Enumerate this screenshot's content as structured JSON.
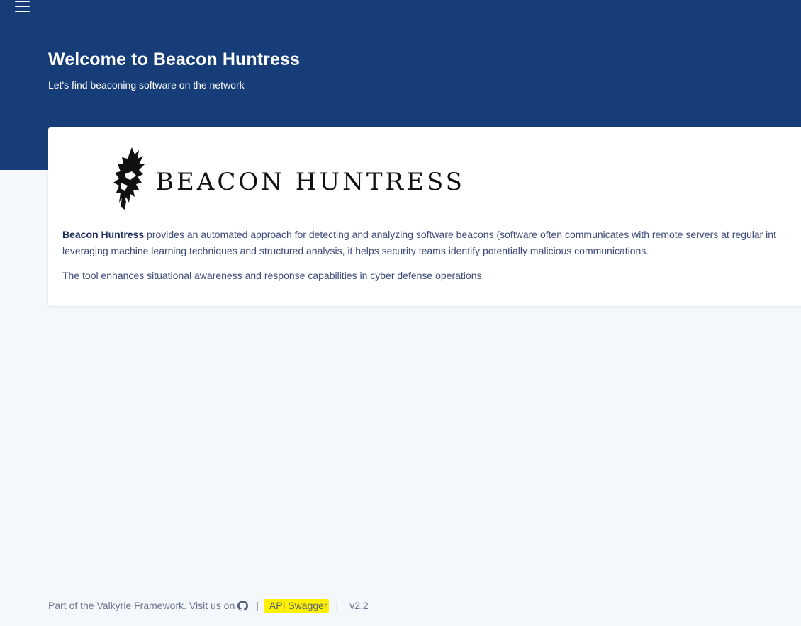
{
  "header": {
    "menu_icon": "hamburger-menu-icon",
    "title": "Welcome to Beacon Huntress",
    "subtitle": "Let's find beaconing software on the network",
    "background_color": "#173d79"
  },
  "card": {
    "logo_icon": "raven-helmet-logo",
    "logo_text": "BEACON HUNTRESS",
    "description_bold": "Beacon Huntress",
    "description_line1": " provides an automated approach for detecting and analyzing software beacons (software often communicates with remote servers at regular int",
    "description_line2": "leveraging machine learning techniques and structured analysis, it helps security teams identify potentially malicious communications.",
    "description_para2": "The tool enhances situational awareness and response capabilities in cyber defense operations."
  },
  "footer": {
    "framework_text": "Part of the Valkyrie Framework. Visit us on",
    "github_icon": "github-icon",
    "separator": "|",
    "swagger_label": "API Swagger",
    "version": "v2.2",
    "highlight_color": "#fff000"
  }
}
